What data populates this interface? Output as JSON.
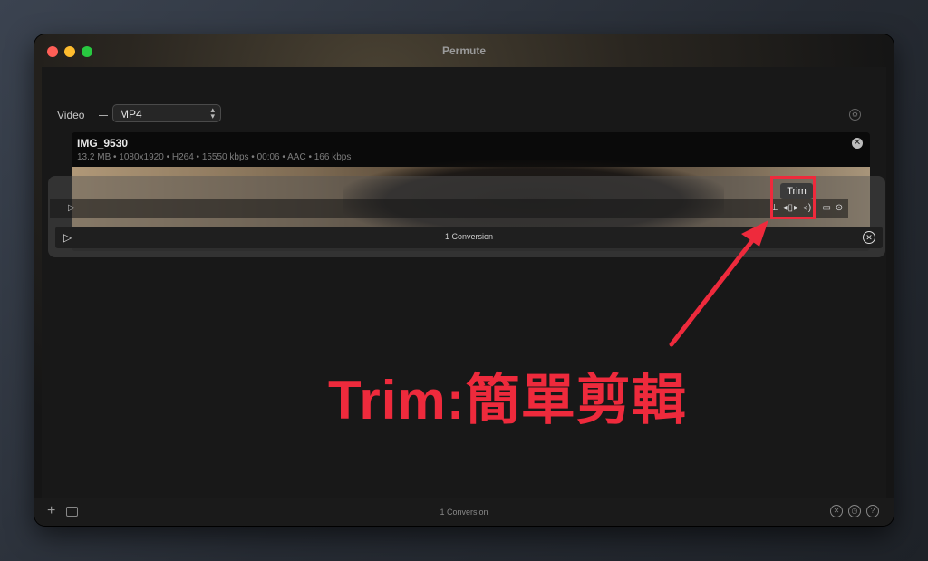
{
  "window": {
    "title": "Permute"
  },
  "toolbar": {
    "format_label": "Video",
    "format_value": "MP4"
  },
  "file": {
    "name": "IMG_9530",
    "meta": "13.2 MB • 1080x1920 • H264 • 15550 kbps • 00:06 • AAC • 166 kbps"
  },
  "tooltip": {
    "text": "Trim"
  },
  "conversion": {
    "label": "1 Conversion"
  },
  "bottom": {
    "label": "1 Conversion"
  },
  "annotation": {
    "text": "Trim:簡單剪輯"
  },
  "icons": {
    "play": "▷",
    "close": "✕",
    "settings": "⊙",
    "add": "+",
    "chevron": "▴▾"
  },
  "colors": {
    "accent": "#ee2a3c",
    "background": "#181818"
  }
}
